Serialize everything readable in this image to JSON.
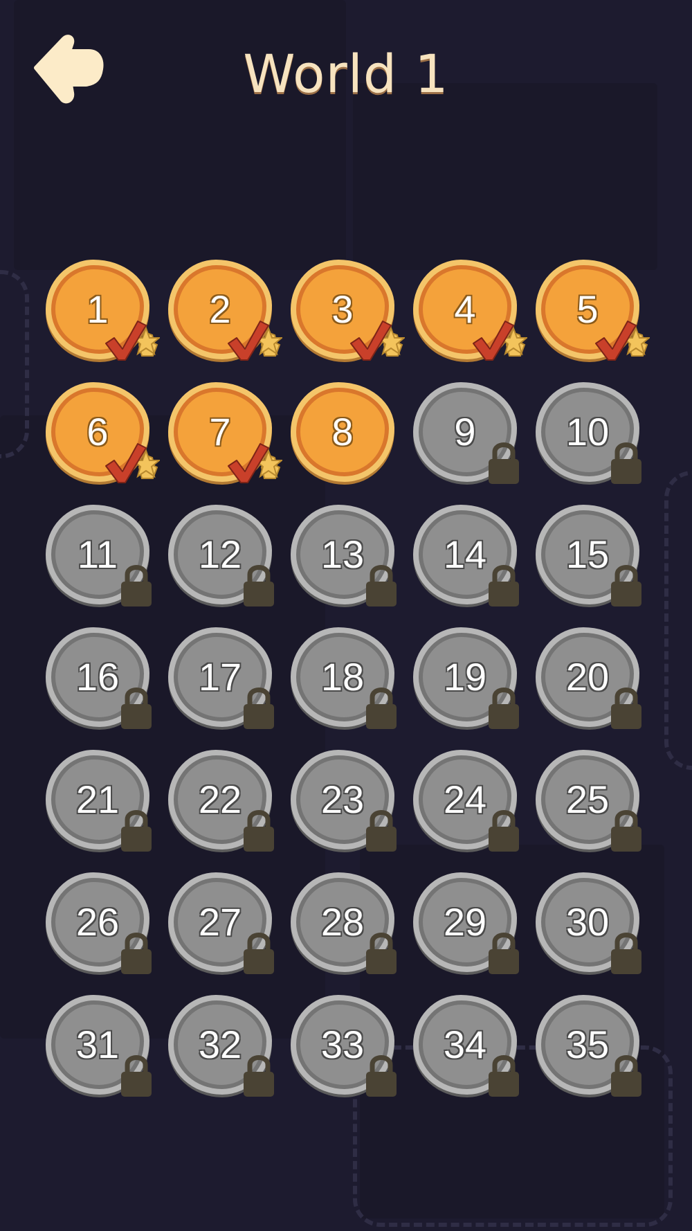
{
  "header": {
    "title": "World 1",
    "back_icon": "back-arrow-icon"
  },
  "colors": {
    "background": "#1d1b2f",
    "unlocked_fill": "#f4a23b",
    "unlocked_ring": "#f4c56a",
    "locked_fill": "#8f8f8f",
    "locked_ring": "#b7b7b7",
    "check": "#c9402a",
    "star": "#f3c45c",
    "lock": "#4a4334",
    "title": "#f7e3bf"
  },
  "levels": [
    {
      "label": "1",
      "state": "completed"
    },
    {
      "label": "2",
      "state": "completed"
    },
    {
      "label": "3",
      "state": "completed"
    },
    {
      "label": "4",
      "state": "completed"
    },
    {
      "label": "5",
      "state": "completed"
    },
    {
      "label": "6",
      "state": "completed"
    },
    {
      "label": "7",
      "state": "completed"
    },
    {
      "label": "8",
      "state": "unlocked"
    },
    {
      "label": "9",
      "state": "locked"
    },
    {
      "label": "10",
      "state": "locked"
    },
    {
      "label": "11",
      "state": "locked"
    },
    {
      "label": "12",
      "state": "locked"
    },
    {
      "label": "13",
      "state": "locked"
    },
    {
      "label": "14",
      "state": "locked"
    },
    {
      "label": "15",
      "state": "locked"
    },
    {
      "label": "16",
      "state": "locked"
    },
    {
      "label": "17",
      "state": "locked"
    },
    {
      "label": "18",
      "state": "locked"
    },
    {
      "label": "19",
      "state": "locked"
    },
    {
      "label": "20",
      "state": "locked"
    },
    {
      "label": "21",
      "state": "locked"
    },
    {
      "label": "22",
      "state": "locked"
    },
    {
      "label": "23",
      "state": "locked"
    },
    {
      "label": "24",
      "state": "locked"
    },
    {
      "label": "25",
      "state": "locked"
    },
    {
      "label": "26",
      "state": "locked"
    },
    {
      "label": "27",
      "state": "locked"
    },
    {
      "label": "28",
      "state": "locked"
    },
    {
      "label": "29",
      "state": "locked"
    },
    {
      "label": "30",
      "state": "locked"
    },
    {
      "label": "31",
      "state": "locked"
    },
    {
      "label": "32",
      "state": "locked"
    },
    {
      "label": "33",
      "state": "locked"
    },
    {
      "label": "34",
      "state": "locked"
    },
    {
      "label": "35",
      "state": "locked"
    }
  ]
}
